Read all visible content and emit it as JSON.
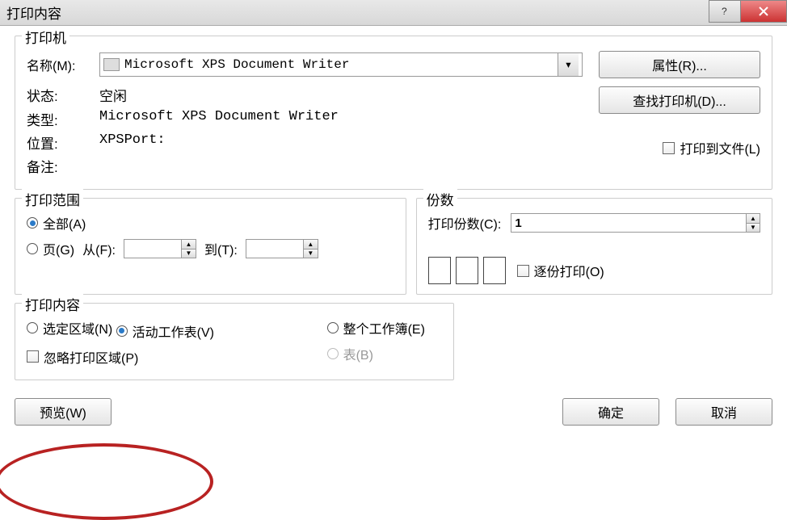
{
  "title": "打印内容",
  "titlebar": {
    "help_icon": "help-icon",
    "close_icon": "close-icon"
  },
  "printer": {
    "group": "打印机",
    "name_label": "名称(M):",
    "name_value": "Microsoft XPS Document Writer",
    "properties_btn": "属性(R)...",
    "find_printer_btn": "查找打印机(D)...",
    "status_label": "状态:",
    "status_value": "空闲",
    "type_label": "类型:",
    "type_value": "Microsoft XPS Document Writer",
    "location_label": "位置:",
    "location_value": "XPSPort:",
    "comment_label": "备注:",
    "comment_value": "",
    "print_to_file": "打印到文件(L)"
  },
  "range": {
    "group": "打印范围",
    "all": "全部(A)",
    "pages": "页(G)",
    "from_label": "从(F):",
    "from_value": "",
    "to_label": "到(T):",
    "to_value": ""
  },
  "copies": {
    "group": "份数",
    "count_label": "打印份数(C):",
    "count_value": "1",
    "collate": "逐份打印(O)"
  },
  "content": {
    "group": "打印内容",
    "selection": "选定区域(N)",
    "workbook": "整个工作簿(E)",
    "active": "活动工作表(V)",
    "table": "表(B)",
    "ignore": "忽略打印区域(P)"
  },
  "buttons": {
    "preview": "预览(W)",
    "ok": "确定",
    "cancel": "取消"
  }
}
